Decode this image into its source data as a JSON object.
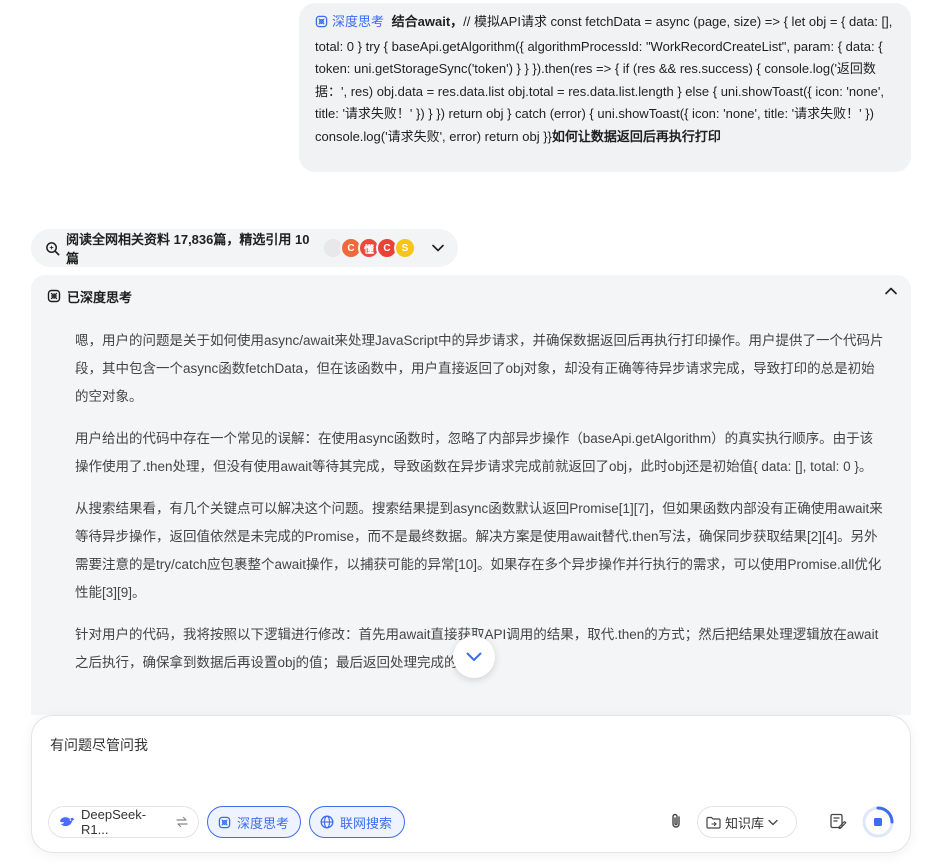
{
  "user_message": {
    "tag_label": "深度思考",
    "prefix_bold": "结合await，",
    "code_text": "// 模拟API请求 const fetchData = async (page, size) => { let obj = { data: [], total: 0 } try { baseApi.getAlgorithm({ algorithmProcessId: \"WorkRecordCreateList\", param: { data: { token: uni.getStorageSync('token') } } }).then(res => { if (res && res.success) { console.log('返回数据：', res) obj.data = res.data.list obj.total = res.data.list.length } else { uni.showToast({ icon: 'none', title: '请求失败！' }) } }) return obj } catch (error) { uni.showToast({ icon: 'none', title: '请求失败！' }) console.log('请求失败', error) return obj }}",
    "suffix_bold": "如何让数据返回后再执行打印"
  },
  "sources": {
    "label": "阅读全网相关资料 17,836篇，精选引用 10篇",
    "favicons": [
      {
        "name": "favicon-1",
        "color": "#e8e8ea",
        "glyph": ""
      },
      {
        "name": "favicon-2",
        "color": "#ef6a3a",
        "glyph": "C"
      },
      {
        "name": "favicon-3",
        "color": "#e84b3c",
        "glyph": "懂"
      },
      {
        "name": "favicon-4",
        "color": "#e94335",
        "glyph": "C"
      },
      {
        "name": "favicon-5",
        "color": "#f5c518",
        "glyph": "S"
      }
    ]
  },
  "thinking": {
    "title": "已深度思考",
    "paragraphs": [
      "嗯，用户的问题是关于如何使用async/await来处理JavaScript中的异步请求，并确保数据返回后再执行打印操作。用户提供了一个代码片段，其中包含一个async函数fetchData，但在该函数中，用户直接返回了obj对象，却没有正确等待异步请求完成，导致打印的总是初始的空对象。",
      "用户给出的代码中存在一个常见的误解：在使用async函数时，忽略了内部异步操作（baseApi.getAlgorithm）的真实执行顺序。由于该操作使用了.then处理，但没有使用await等待其完成，导致函数在异步请求完成前就返回了obj，此时obj还是初始值{ data: [], total: 0 }。",
      "从搜索结果看，有几个关键点可以解决这个问题。搜索结果提到async函数默认返回Promise[1][7]，但如果函数内部没有正确使用await来等待异步操作，返回值依然是未完成的Promise，而不是最终数据。解决方案是使用await替代.then写法，确保同步获取结果[2][4]。另外需要注意的是try/catch应包裹整个await操作，以捕获可能的异常[10]。如果存在多个异步操作并行执行的需求，可以使用Promise.all优化性能[3][9]。",
      "针对用户的代码，我将按照以下逻辑进行修改：首先用await直接获取API调用的结果，取代.then的方式；然后把结果处理逻辑放在await之后执行，确保拿到数据后再设置obj的值；最后返回处理完成的obj。"
    ]
  },
  "composer": {
    "placeholder": "有问题尽管问我",
    "model_label": "DeepSeek-R1...",
    "deep_think_label": "深度思考",
    "web_search_label": "联网搜索",
    "knowledge_label": "知识库"
  },
  "colors": {
    "accent": "#3c6cf0",
    "panel_bg": "#f4f5f7",
    "bubble_bg": "#f1f2f4"
  }
}
